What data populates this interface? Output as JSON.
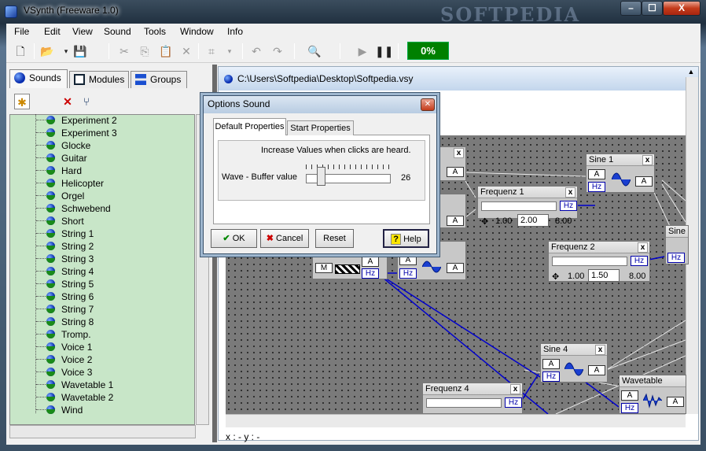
{
  "window": {
    "title": "VSynth (Freeware 1.0)",
    "watermark": "SOFTPEDIA",
    "min": "–",
    "max": "☐",
    "close": "X"
  },
  "menu": [
    "File",
    "Edit",
    "View",
    "Sound",
    "Tools",
    "Window",
    "Info"
  ],
  "toolbar": {
    "icons": [
      "new-icon",
      "open-icon",
      "save-icon",
      "cut-icon",
      "copy-icon",
      "paste-icon",
      "delete-icon",
      "grid-icon",
      "undo-icon",
      "redo-icon",
      "search-icon",
      "play-icon",
      "pause-icon"
    ],
    "progress": "0%"
  },
  "left": {
    "tabs": [
      "Sounds",
      "Modules",
      "Groups"
    ],
    "tree": [
      "Experiment 2",
      "Experiment 3",
      "Glocke",
      "Guitar",
      "Hard",
      "Helicopter",
      "Orgel",
      "Schwebend",
      "Short",
      "String 1",
      "String 2",
      "String 3",
      "String 4",
      "String 5",
      "String 6",
      "String 7",
      "String 8",
      "Tromp.",
      "Voice 1",
      "Voice 2",
      "Voice 3",
      "Wavetable 1",
      "Wavetable 2",
      "Wind"
    ]
  },
  "doc": {
    "title": "C:\\Users\\Softpedia\\Desktop\\Softpedia.vsy",
    "status": "x : -   y : -",
    "modules": {
      "frequenz1": {
        "title": "Frequenz 1",
        "min": "1.00",
        "value": "2.00",
        "max": "8.00"
      },
      "frequenz2": {
        "title": "Frequenz 2",
        "min": "1.00",
        "value": "1.50",
        "max": "8.00"
      },
      "frequenz4": {
        "title": "Frequenz 4"
      },
      "sine1": {
        "title": "Sine 1"
      },
      "sine4": {
        "title": "Sine 4"
      },
      "sine_partial": {
        "title": "Sine"
      },
      "wavetable": {
        "title": "Wavetable"
      },
      "port_a": "A",
      "port_hz": "Hz",
      "port_m": "M",
      "close": "x"
    }
  },
  "dialog": {
    "title": "Options Sound",
    "tabs": [
      "Default Properties",
      "Start Properties"
    ],
    "description": "Increase Values when clicks are heard.",
    "label": "Wave - Buffer value",
    "value": "26",
    "slider_fraction": 0.14,
    "buttons": {
      "ok": "OK",
      "cancel": "Cancel",
      "reset": "Reset",
      "help": "Help"
    }
  },
  "colors": {
    "tree_bg": "#c8e6c8",
    "progress_bg": "#008000",
    "wire": "#0000cc",
    "canvas": "#7a7a7a"
  }
}
